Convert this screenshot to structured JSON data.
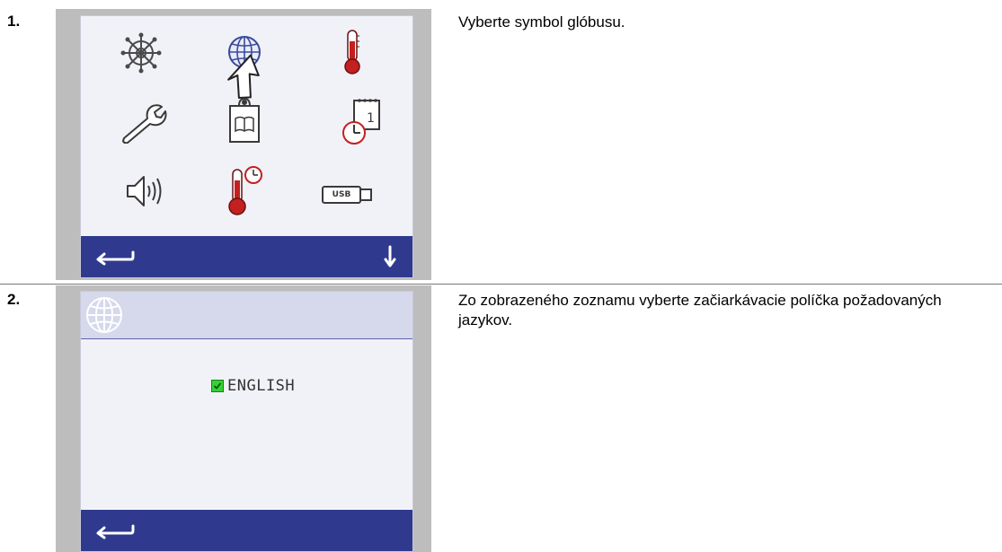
{
  "steps": [
    {
      "number": "1.",
      "instruction": "Vyberte symbol glóbusu.",
      "screen": {
        "icons": [
          "ship-wheel-icon",
          "globe-icon",
          "thermometer-icon",
          "wrench-icon",
          "manual-book-icon",
          "calendar-clock-icon",
          "speaker-icon",
          "thermometer-clock-icon",
          "usb-drive-icon"
        ],
        "usb_label": "USB",
        "calendar_day": "1",
        "nav": [
          "back-arrow-icon",
          "down-arrow-icon"
        ]
      }
    },
    {
      "number": "2.",
      "instruction": "Zo zobrazeného zoznamu vyberte začiarkávacie políčka požadovaných jazykov.",
      "screen": {
        "header_icon": "globe-icon",
        "languages": [
          {
            "label": "ENGLISH",
            "checked": true
          }
        ],
        "nav": [
          "back-arrow-icon"
        ]
      }
    }
  ],
  "colors": {
    "nav_bar": "#2f3a8f",
    "screen_bg": "#f1f1f8",
    "frame": "#bdbdbd",
    "icon_blue": "#3a4a9a",
    "thermo_red": "#c42020",
    "checkbox_green": "#35d135"
  }
}
